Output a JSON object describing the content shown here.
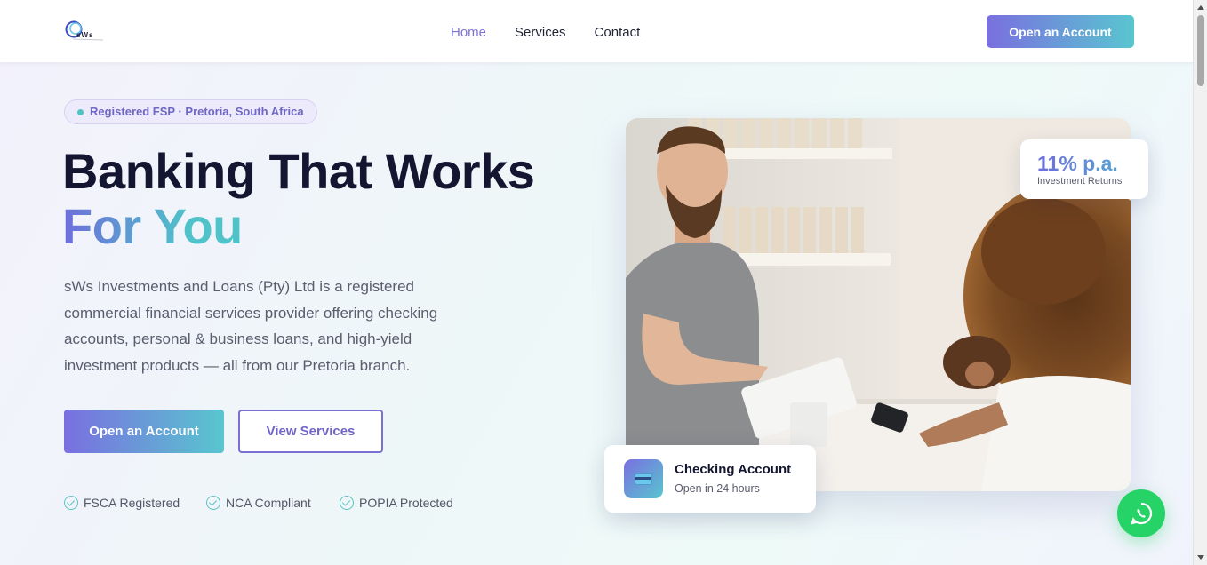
{
  "header": {
    "logo_text": "sWs",
    "nav": [
      {
        "label": "Home",
        "active": true
      },
      {
        "label": "Services",
        "active": false
      },
      {
        "label": "Contact",
        "active": false
      }
    ],
    "cta_label": "Open an Account"
  },
  "hero": {
    "badge": "Registered FSP · Pretoria, South Africa",
    "title_line1": "Banking That Works",
    "title_line2": "For You",
    "lead": "sWs Investments and Loans (Pty) Ltd is a registered commercial financial services provider offering checking accounts, personal & business loans, and high-yield investment products — all from our Pretoria branch.",
    "primary_button": "Open an Account",
    "secondary_button": "View Services",
    "trust": [
      "FSCA Registered",
      "NCA Compliant",
      "POPIA Protected"
    ]
  },
  "stat_card": {
    "value": "11% p.a.",
    "label": "Investment Returns"
  },
  "account_card": {
    "title": "Checking Account",
    "subtitle": "Open in 24 hours",
    "icon": "credit-card-icon"
  },
  "floating": {
    "icon": "whatsapp-icon"
  },
  "colors": {
    "accent_purple": "#7a6fe0",
    "accent_teal": "#58c6cf",
    "heading": "#141631",
    "whatsapp": "#25d366"
  }
}
